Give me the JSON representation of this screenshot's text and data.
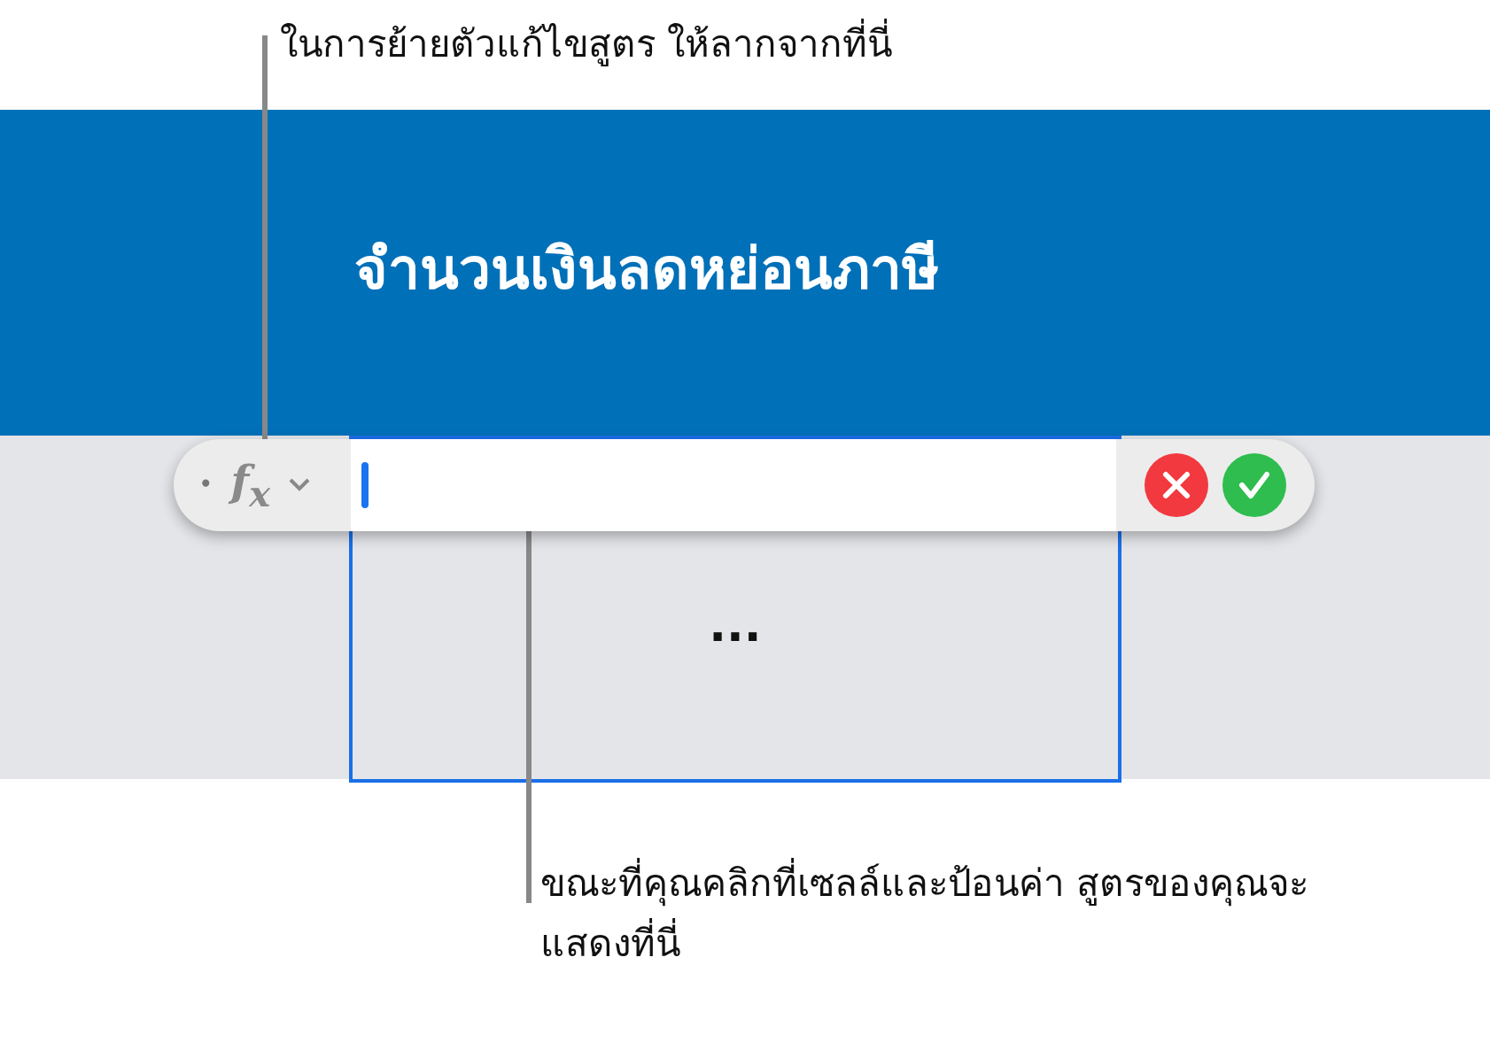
{
  "callouts": [
    {
      "kind": "top",
      "text": "ในการย้ายตัวแก้ไขสูตร ให้ลากจากที่นี่"
    },
    {
      "kind": "bottom",
      "text": "ขณะที่คุณคลิกที่เซลล์และป้อนค่า สูตรของคุณจะแสดงที่นี่"
    }
  ],
  "header": {
    "title": "จำนวนเงินลดหย่อนภาษี"
  },
  "cell": {
    "text": "...",
    "selected": true
  },
  "formula_bar": {
    "handle": "•",
    "function_label": "f$_{x}$"
  }
}
